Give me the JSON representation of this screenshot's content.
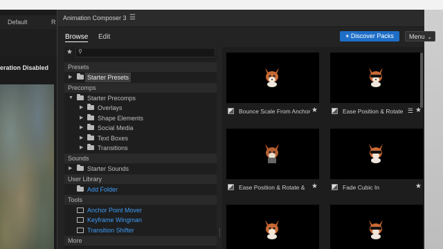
{
  "host": {
    "tab_default": "Default",
    "tab_r": "R",
    "status_text": "eration Disabled"
  },
  "panel": {
    "title": "Animation Composer 3",
    "tabs": [
      "Browse",
      "Edit"
    ],
    "discover_label": "Discover Packs",
    "menu_label": "Menu"
  },
  "tree": {
    "sections": {
      "presets": "Presets",
      "precomps": "Precomps",
      "sounds": "Sounds",
      "user_library": "User Library",
      "tools": "Tools",
      "more": "More"
    },
    "items": {
      "starter_presets": "Starter Presets",
      "starter_precomps": "Starter Precomps",
      "overlays": "Overlays",
      "shape_elements": "Shape Elements",
      "social_media": "Social Media",
      "text_boxes": "Text Boxes",
      "transitions": "Transitions",
      "starter_sounds": "Starter Sounds",
      "add_folder": "Add Folder",
      "anchor_point_mover": "Anchor Point Mover",
      "keyframe_wingman": "Keyframe Wingman",
      "transition_shifter": "Transition Shifter"
    }
  },
  "grid": {
    "cards": [
      {
        "label": "Bounce Scale From Anchor"
      },
      {
        "label": "Ease Position & Rotate"
      },
      {
        "label": "Ease Position & Rotate &"
      },
      {
        "label": "Fade Cubic In"
      }
    ]
  },
  "colors": {
    "accent": "#1e6ec7",
    "link": "#3e9cf5"
  }
}
